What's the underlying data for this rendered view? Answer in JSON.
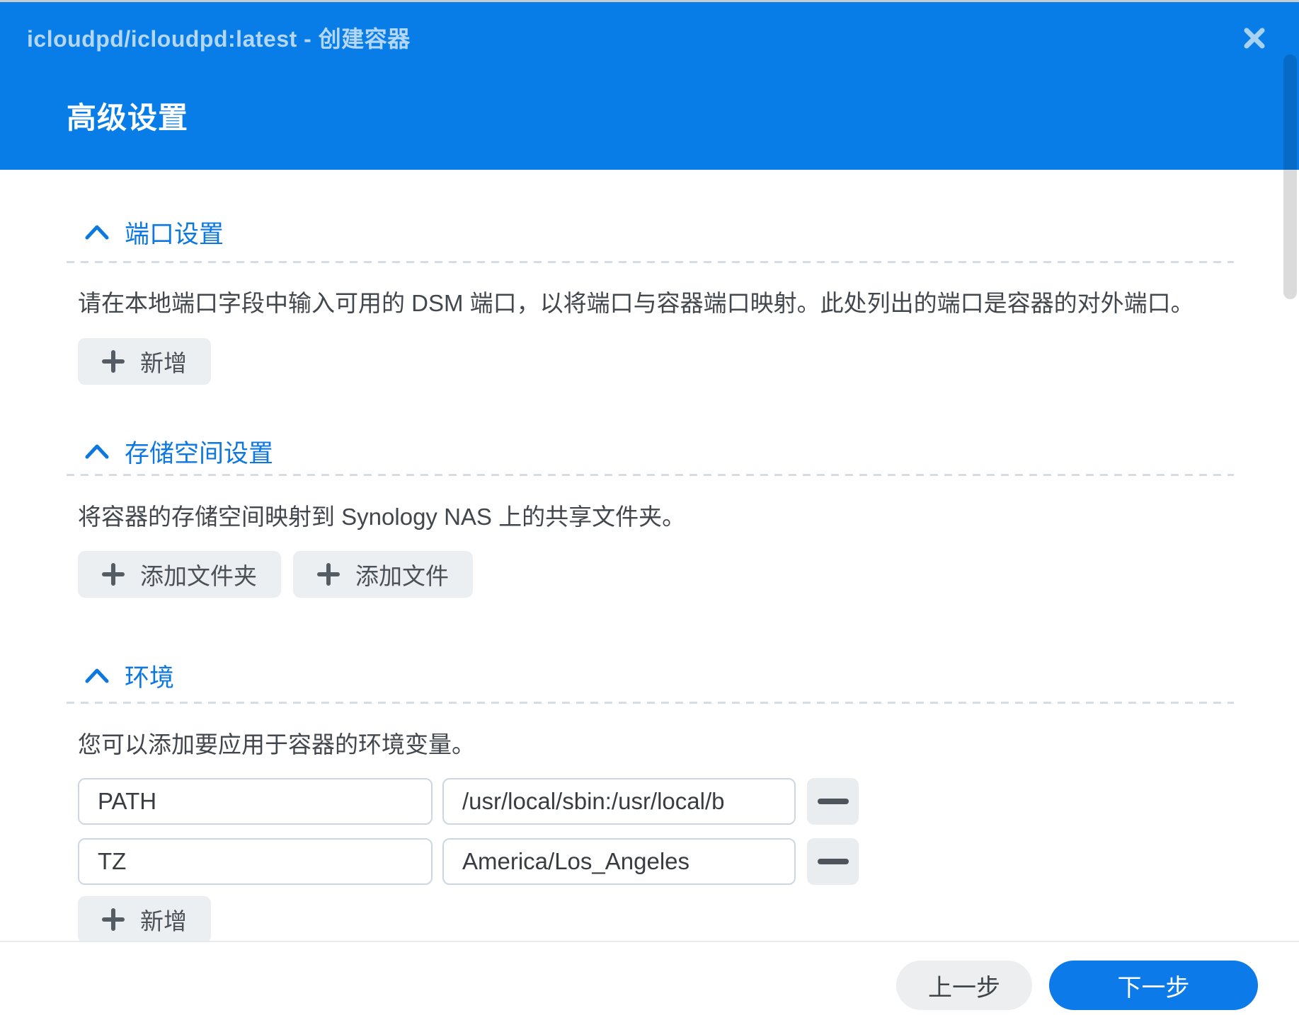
{
  "titlebar": {
    "title": "icloudpd/icloudpd:latest - 创建容器",
    "close_icon": "close-x"
  },
  "header": {
    "heading": "高级设置"
  },
  "sections": [
    {
      "id": "port-settings",
      "title": "端口设置",
      "collapse_icon": "chevron-up",
      "description": "请在本地端口字段中输入可用的 DSM 端口，以将端口与容器端口映射。此处列出的端口是容器的对外端口。",
      "buttons": [
        {
          "icon": "plus",
          "label": "新增"
        }
      ]
    },
    {
      "id": "volume-settings",
      "title": "存储空间设置",
      "collapse_icon": "chevron-up",
      "description": "将容器的存储空间映射到 Synology NAS 上的共享文件夹。",
      "buttons": [
        {
          "icon": "plus",
          "label": "添加文件夹"
        },
        {
          "icon": "plus",
          "label": "添加文件"
        }
      ]
    },
    {
      "id": "environment",
      "title": "环境",
      "collapse_icon": "chevron-up",
      "description": "您可以添加要应用于容器的环境变量。",
      "env_vars": [
        {
          "key": "PATH",
          "value": "/usr/local/sbin:/usr/local/b",
          "remove_icon": "minus"
        },
        {
          "key": "TZ",
          "value": "America/Los_Angeles",
          "remove_icon": "minus"
        }
      ],
      "add_button": {
        "icon": "plus",
        "label": "新增"
      }
    }
  ],
  "footer": {
    "back_label": "上一步",
    "next_label": "下一步"
  },
  "colors": {
    "header_blue": "#087de8",
    "section_title_blue": "#0d78e0",
    "primary_button_blue": "#0c7ae8",
    "gray_button_bg": "#eceff1",
    "input_border": "#cdd7e1",
    "body_text": "#42474d",
    "close_icon_tint": "#a8d2f4"
  }
}
